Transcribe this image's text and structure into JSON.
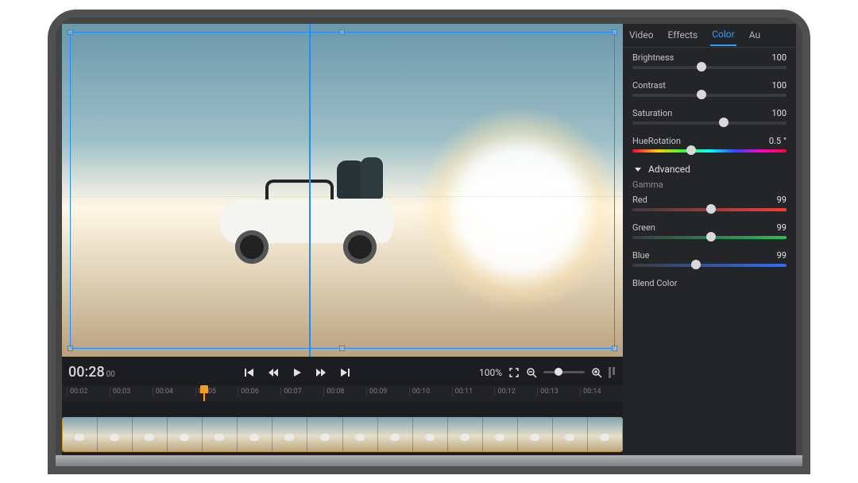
{
  "panel": {
    "tabs": {
      "video": "Video",
      "effects": "Effects",
      "color": "Color",
      "audio": "Au"
    },
    "active_tab": "color",
    "brightness": {
      "label": "Brightness",
      "value": "100"
    },
    "contrast": {
      "label": "Contrast",
      "value": "100"
    },
    "saturation": {
      "label": "Saturation",
      "value": "100"
    },
    "hue": {
      "label": "HueRotation",
      "value": "0.5 °"
    },
    "advanced_label": "Advanced",
    "gamma_label": "Gamma",
    "red": {
      "label": "Red",
      "value": "99"
    },
    "green": {
      "label": "Green",
      "value": "99"
    },
    "blue": {
      "label": "Blue",
      "value": "99"
    },
    "blend_label": "Blend Color"
  },
  "transport": {
    "timecode": "00:28",
    "timecode_sub": "00",
    "zoom_label": "100%"
  },
  "ruler": {
    "t0": "00:02",
    "t1": "00:03",
    "t2": "00:04",
    "t3": "00:05",
    "t4": "00:06",
    "t5": "00:07",
    "t6": "00:08",
    "t7": "00:09",
    "t8": "00:10",
    "t9": "00:11",
    "t10": "00:12",
    "t11": "00:13",
    "t12": "00:14"
  }
}
